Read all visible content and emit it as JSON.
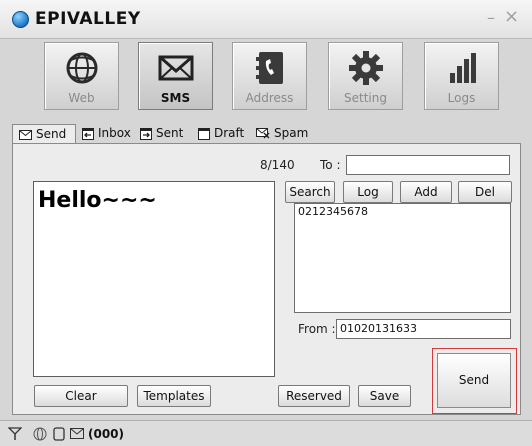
{
  "window": {
    "title": "EPIVALLEY",
    "minimize_symbol": "–",
    "close_symbol": "×"
  },
  "nav": [
    {
      "label": "Web",
      "icon": "globe-icon"
    },
    {
      "label": "SMS",
      "icon": "envelope-icon",
      "active": true
    },
    {
      "label": "Address",
      "icon": "address-book-icon"
    },
    {
      "label": "Setting",
      "icon": "gear-icon"
    },
    {
      "label": "Logs",
      "icon": "bar-chart-icon"
    }
  ],
  "tabs": [
    {
      "label": "Send",
      "icon": "envelope-icon",
      "active": true
    },
    {
      "label": "Inbox",
      "icon": "inbox-icon"
    },
    {
      "label": "Sent",
      "icon": "sent-icon"
    },
    {
      "label": "Draft",
      "icon": "draft-icon"
    },
    {
      "label": "Spam",
      "icon": "spam-icon"
    }
  ],
  "compose": {
    "counter": "8/140",
    "message": "Hello~~~",
    "to_label": "To :",
    "to_value": "",
    "from_label": "From :",
    "from_value": "01020131633",
    "recipients": [
      "0212345678"
    ]
  },
  "buttons": {
    "search": "Search",
    "log": "Log",
    "add": "Add",
    "del": "Del",
    "clear": "Clear",
    "templates": "Templates",
    "reserved": "Reserved",
    "save": "Save",
    "send": "Send"
  },
  "status": {
    "count_text": "(000)"
  },
  "colors": {
    "accent": "#b833c0",
    "send_highlight": "#d6393a"
  }
}
